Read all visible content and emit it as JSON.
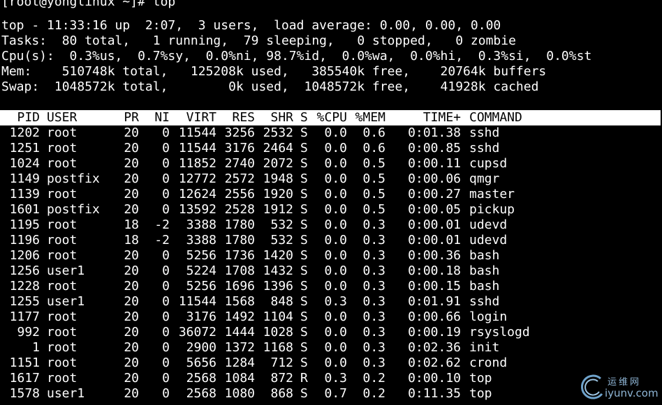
{
  "terminal": {
    "prompt_line": "[root@yonglinux ~]# top",
    "summary": [
      "top - 11:33:16 up  2:07,  3 users,  load average: 0.00, 0.00, 0.00",
      "Tasks:  80 total,   1 running,  79 sleeping,   0 stopped,   0 zombie",
      "Cpu(s):  0.3%us,  0.7%sy,  0.0%ni, 98.7%id,  0.0%wa,  0.0%hi,  0.3%si,  0.0%st",
      "Mem:    510748k total,   125208k used,   385540k free,    20764k buffers",
      "Swap:  1048572k total,        0k used,  1048572k free,    41928k cached"
    ],
    "columns": [
      "PID",
      "USER",
      "PR",
      "NI",
      "VIRT",
      "RES",
      "SHR",
      "S",
      "%CPU",
      "%MEM",
      "TIME+",
      "COMMAND"
    ],
    "processes": [
      [
        "1202",
        "root",
        "20",
        "0",
        "11544",
        "3256",
        "2532",
        "S",
        "0.0",
        "0.6",
        "0:01.38",
        "sshd"
      ],
      [
        "1251",
        "root",
        "20",
        "0",
        "11544",
        "3176",
        "2464",
        "S",
        "0.0",
        "0.6",
        "0:00.85",
        "sshd"
      ],
      [
        "1024",
        "root",
        "20",
        "0",
        "11852",
        "2740",
        "2072",
        "S",
        "0.0",
        "0.5",
        "0:00.11",
        "cupsd"
      ],
      [
        "1149",
        "postfix",
        "20",
        "0",
        "12772",
        "2572",
        "1948",
        "S",
        "0.0",
        "0.5",
        "0:00.06",
        "qmgr"
      ],
      [
        "1139",
        "root",
        "20",
        "0",
        "12624",
        "2556",
        "1920",
        "S",
        "0.0",
        "0.5",
        "0:00.27",
        "master"
      ],
      [
        "1601",
        "postfix",
        "20",
        "0",
        "13592",
        "2528",
        "1912",
        "S",
        "0.0",
        "0.5",
        "0:00.05",
        "pickup"
      ],
      [
        "1195",
        "root",
        "18",
        "-2",
        "3388",
        "1780",
        "532",
        "S",
        "0.0",
        "0.3",
        "0:00.01",
        "udevd"
      ],
      [
        "1196",
        "root",
        "18",
        "-2",
        "3388",
        "1780",
        "532",
        "S",
        "0.0",
        "0.3",
        "0:00.01",
        "udevd"
      ],
      [
        "1206",
        "root",
        "20",
        "0",
        "5256",
        "1736",
        "1420",
        "S",
        "0.0",
        "0.3",
        "0:00.36",
        "bash"
      ],
      [
        "1256",
        "user1",
        "20",
        "0",
        "5224",
        "1708",
        "1432",
        "S",
        "0.0",
        "0.3",
        "0:00.18",
        "bash"
      ],
      [
        "1228",
        "root",
        "20",
        "0",
        "5256",
        "1696",
        "1396",
        "S",
        "0.0",
        "0.3",
        "0:00.15",
        "bash"
      ],
      [
        "1255",
        "user1",
        "20",
        "0",
        "11544",
        "1568",
        "848",
        "S",
        "0.3",
        "0.3",
        "0:01.91",
        "sshd"
      ],
      [
        "1177",
        "root",
        "20",
        "0",
        "3176",
        "1492",
        "1104",
        "S",
        "0.0",
        "0.3",
        "0:00.66",
        "login"
      ],
      [
        "992",
        "root",
        "20",
        "0",
        "36072",
        "1444",
        "1028",
        "S",
        "0.0",
        "0.3",
        "0:00.19",
        "rsyslogd"
      ],
      [
        "1",
        "root",
        "20",
        "0",
        "2900",
        "1372",
        "1168",
        "S",
        "0.0",
        "0.3",
        "0:02.36",
        "init"
      ],
      [
        "1151",
        "root",
        "20",
        "0",
        "5656",
        "1284",
        "712",
        "S",
        "0.0",
        "0.3",
        "0:02.62",
        "crond"
      ],
      [
        "1617",
        "root",
        "20",
        "0",
        "2568",
        "1084",
        "872",
        "R",
        "0.3",
        "0.2",
        "0:00.10",
        "top"
      ],
      [
        "1578",
        "user1",
        "20",
        "0",
        "2568",
        "1080",
        "868",
        "S",
        "0.7",
        "0.2",
        "0:11.35",
        "top"
      ]
    ],
    "colors": {
      "background": "#000000",
      "foreground": "#ffffff",
      "header_bar": "#ffffff",
      "header_text": "#000000"
    }
  },
  "watermark": {
    "top_text": "运维网",
    "bottom_text": "iyunv.com",
    "icon": "watermark-logo-icon"
  }
}
